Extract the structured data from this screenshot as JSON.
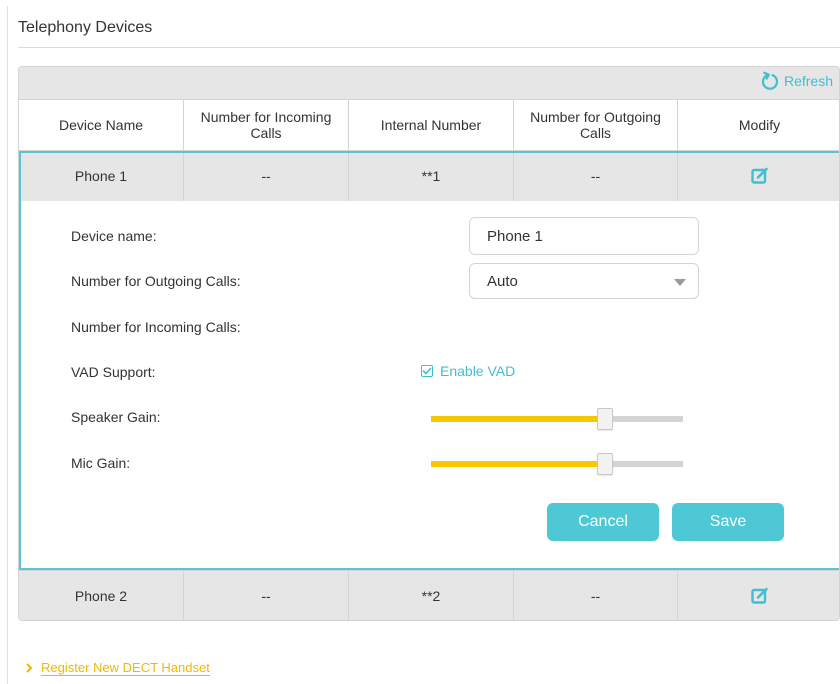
{
  "page": {
    "title": "Telephony Devices"
  },
  "toolbar": {
    "refresh_label": "Refresh",
    "refresh_icon": "refresh-icon"
  },
  "table": {
    "headers": [
      "Device Name",
      "Number for Incoming Calls",
      "Internal Number",
      "Number for Outgoing Calls",
      "Modify"
    ],
    "rows": [
      {
        "device_name": "Phone 1",
        "incoming": "--",
        "internal": "**1",
        "outgoing": "--",
        "modify_icon": "edit-icon"
      },
      {
        "device_name": "Phone 2",
        "incoming": "--",
        "internal": "**2",
        "outgoing": "--",
        "modify_icon": "edit-icon"
      }
    ]
  },
  "edit_form": {
    "device_name_label": "Device name:",
    "device_name_value": "Phone 1",
    "outgoing_label": "Number for Outgoing Calls:",
    "outgoing_value": "Auto",
    "incoming_label": "Number for Incoming Calls:",
    "vad_label": "VAD Support:",
    "vad_checkbox_label": "Enable VAD",
    "vad_checked": true,
    "speaker_gain_label": "Speaker Gain:",
    "speaker_gain_fraction": 0.69,
    "mic_gain_label": "Mic Gain:",
    "mic_gain_fraction": 0.69,
    "cancel_label": "Cancel",
    "save_label": "Save"
  },
  "footer": {
    "register_link": "Register New DECT Handset"
  },
  "colors": {
    "accent": "#4fc8d6",
    "link": "#3fbfd2",
    "slider_fill": "#f9c700",
    "link_yellow": "#f2b705"
  }
}
